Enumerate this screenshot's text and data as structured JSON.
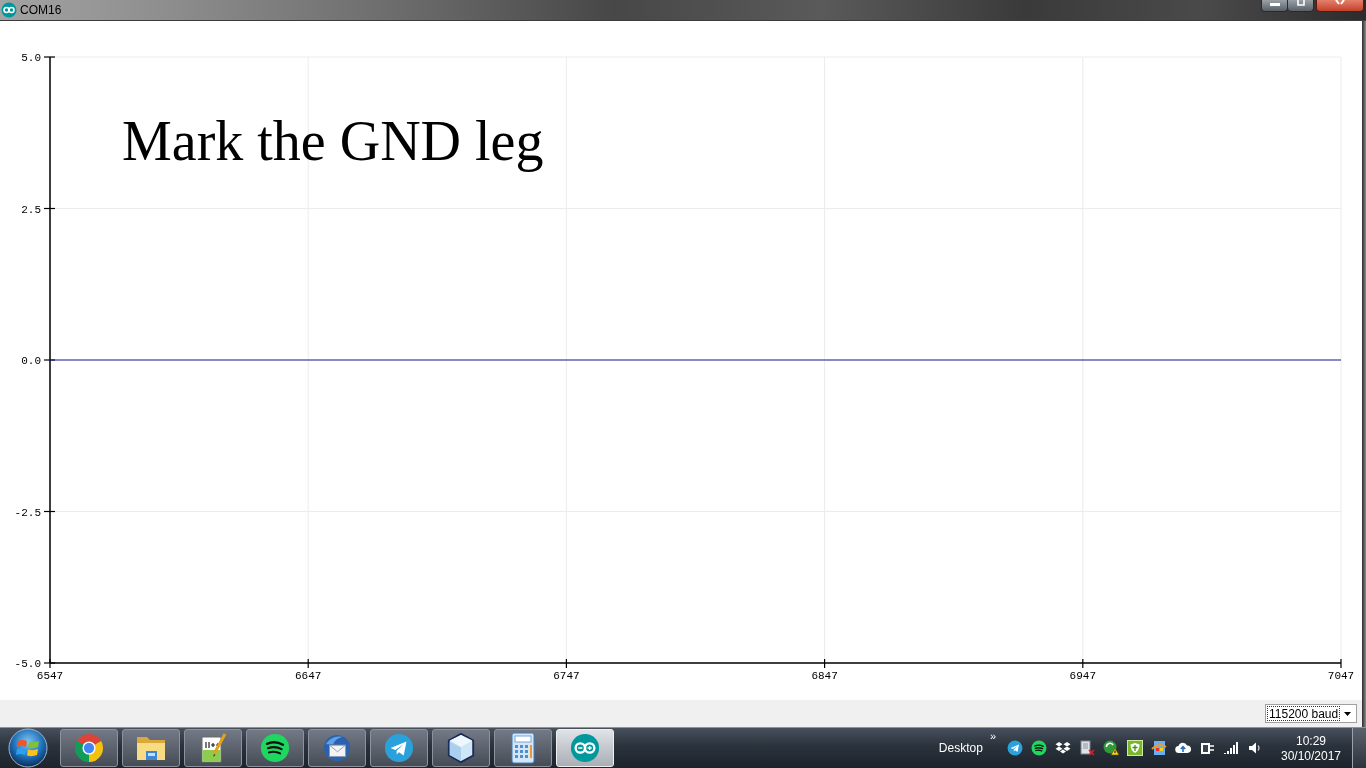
{
  "window": {
    "title": "COM16"
  },
  "plot": {
    "chart_data": {
      "type": "line",
      "x": [
        6547,
        7047
      ],
      "series": [
        {
          "color": "#1c1c9c",
          "values": [
            0,
            0
          ]
        }
      ],
      "xlim": [
        6547,
        7047
      ],
      "ylim": [
        -5,
        5
      ],
      "xticks": [
        6547,
        6647,
        6747,
        6847,
        6947,
        7047
      ],
      "yticks": [
        {
          "value": -5,
          "label": "-5.0"
        },
        {
          "value": -2.5,
          "label": "-2.5"
        },
        {
          "value": 0,
          "label": "0.0"
        },
        {
          "value": 2.5,
          "label": "2.5"
        },
        {
          "value": 5,
          "label": "5.0"
        }
      ],
      "grid": true,
      "annotations": [
        "Mark the GND leg"
      ]
    }
  },
  "baud_rate": {
    "value": "115200 baud"
  },
  "taskbar": {
    "apps": [
      {
        "selected": false
      },
      {
        "selected": false
      },
      {
        "selected": false
      },
      {
        "selected": false
      },
      {
        "selected": false
      },
      {
        "selected": false
      },
      {
        "selected": false
      },
      {
        "selected": false
      },
      {
        "selected": true
      }
    ],
    "toolbar_label": "Desktop",
    "toolbar_overflow": "»",
    "clock": {
      "time": "10:29",
      "date": "30/10/2017"
    }
  }
}
